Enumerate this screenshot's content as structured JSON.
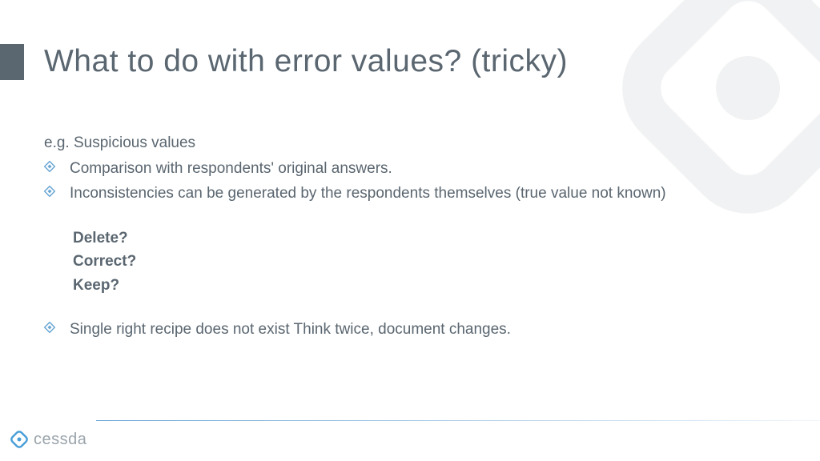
{
  "title": "What to do with error values? (tricky)",
  "content": {
    "subtitle": "e.g. Suspicious values",
    "bullets": [
      "Comparison with respondents' original answers.",
      "Inconsistencies can be generated by the respondents themselves (true value not known)"
    ],
    "bold_questions": [
      "Delete?",
      "Correct?",
      "Keep?"
    ],
    "final_bullet": "Single right recipe does not exist  Think twice, document changes."
  },
  "logo_text": "cessda"
}
